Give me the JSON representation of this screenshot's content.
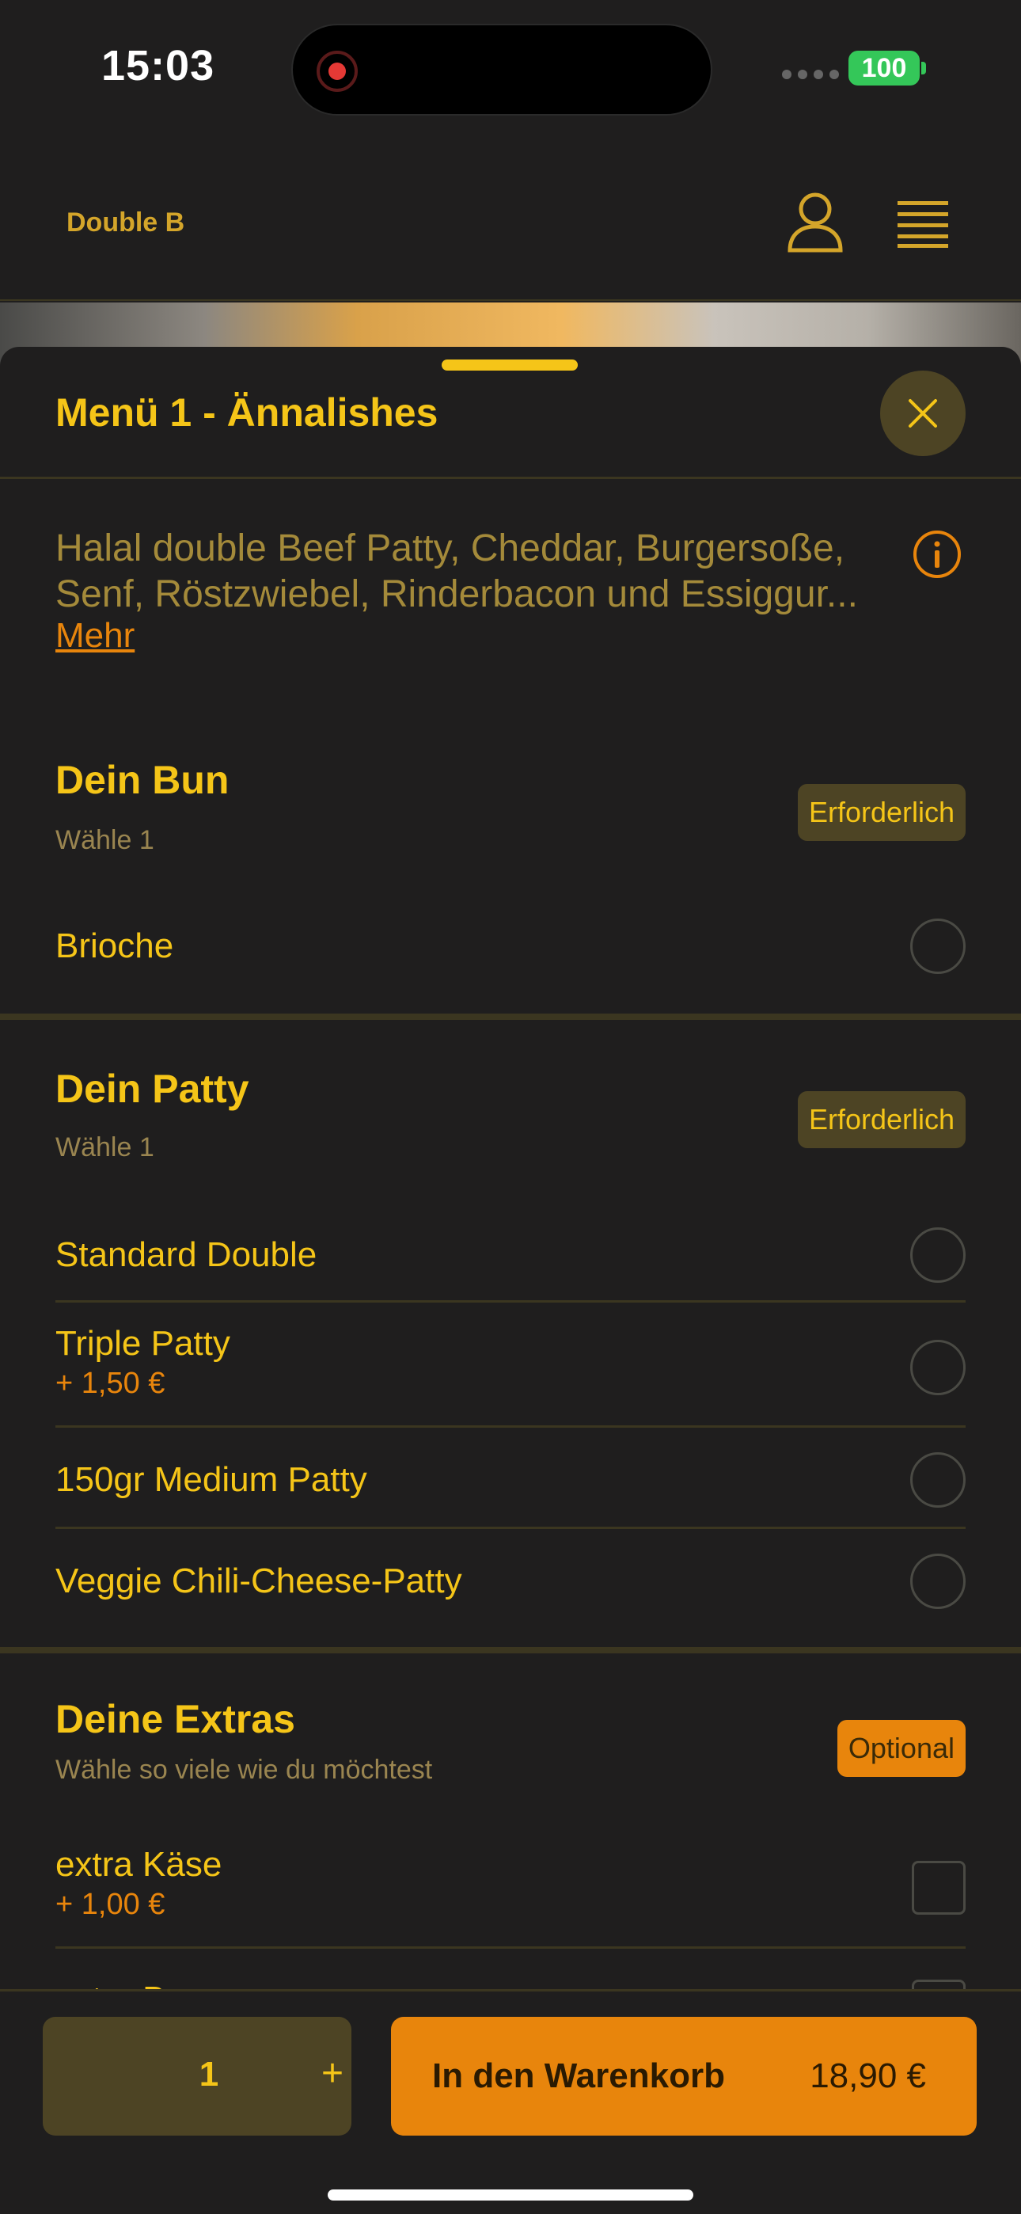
{
  "status_bar": {
    "time": "15:03",
    "battery": "100"
  },
  "header": {
    "brand": "Double B"
  },
  "sheet": {
    "title": "Menü 1 - Ännalishes",
    "description": "Halal double Beef Patty, Cheddar, Burgersoße,\nSenf, Röstzwiebel, Rinderbacon und Essiggur...",
    "more_link": "Mehr"
  },
  "groups": [
    {
      "title": "Dein Bun",
      "subtitle": "Wähle 1",
      "badge": "Erforderlich",
      "options": [
        {
          "label": "Brioche",
          "price": ""
        }
      ]
    },
    {
      "title": "Dein Patty",
      "subtitle": "Wähle 1",
      "badge": "Erforderlich",
      "options": [
        {
          "label": "Standard Double",
          "price": ""
        },
        {
          "label": "Triple Patty",
          "price": "+ 1,50 €"
        },
        {
          "label": "150gr Medium Patty",
          "price": ""
        },
        {
          "label": "Veggie Chili-Cheese-Patty",
          "price": ""
        }
      ]
    },
    {
      "title": "Deine Extras",
      "subtitle": "Wähle so viele wie du möchtest",
      "badge": "Optional",
      "options": [
        {
          "label": "extra Käse",
          "price": "+ 1,00 €"
        },
        {
          "label": "extra Bacon",
          "price": ""
        }
      ]
    }
  ],
  "cart": {
    "quantity": "1",
    "plus": "+",
    "button_label": "In den Warenkorb",
    "total": "18,90 €"
  },
  "colors": {
    "accent": "#f5c518",
    "orange": "#e8850c",
    "background": "#1f1e1e"
  }
}
